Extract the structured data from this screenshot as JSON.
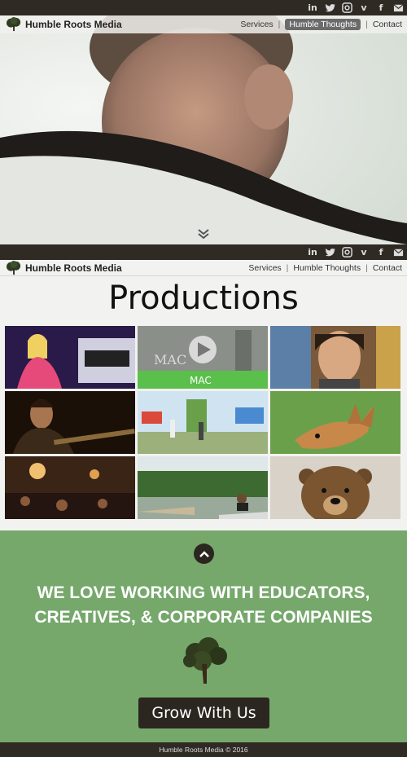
{
  "brand": {
    "name": "Humble Roots Media"
  },
  "social": [
    {
      "icon": "linkedin-icon",
      "glyph": "in"
    },
    {
      "icon": "twitter-icon",
      "glyph": ""
    },
    {
      "icon": "instagram-icon",
      "glyph": ""
    },
    {
      "icon": "vimeo-icon",
      "glyph": "v"
    },
    {
      "icon": "facebook-icon",
      "glyph": "f"
    },
    {
      "icon": "mail-icon",
      "glyph": ""
    }
  ],
  "nav": {
    "services": "Services",
    "thoughts": "Humble Thoughts",
    "contact": "Contact",
    "separator": "|"
  },
  "productions": {
    "title": "Productions",
    "tiles": [
      {
        "name": "singer-performance"
      },
      {
        "name": "mac-video",
        "text": "MAC",
        "overlay": "MAC"
      },
      {
        "name": "smiling-woman"
      },
      {
        "name": "guitarist"
      },
      {
        "name": "playground"
      },
      {
        "name": "fox"
      },
      {
        "name": "restaurant-interior"
      },
      {
        "name": "canoe-lake"
      },
      {
        "name": "bear"
      }
    ]
  },
  "cta": {
    "tagline_line1": "WE LOVE WORKING WITH EDUCATORS,",
    "tagline_line2": "CREATIVES, & CORPORATE COMPANIES",
    "button": "Grow With Us"
  },
  "footer": {
    "text": "Humble Roots Media © 2016"
  },
  "colors": {
    "dark": "#2f2a24",
    "green": "#76a86c",
    "active_nav": "#6b6b6b"
  }
}
